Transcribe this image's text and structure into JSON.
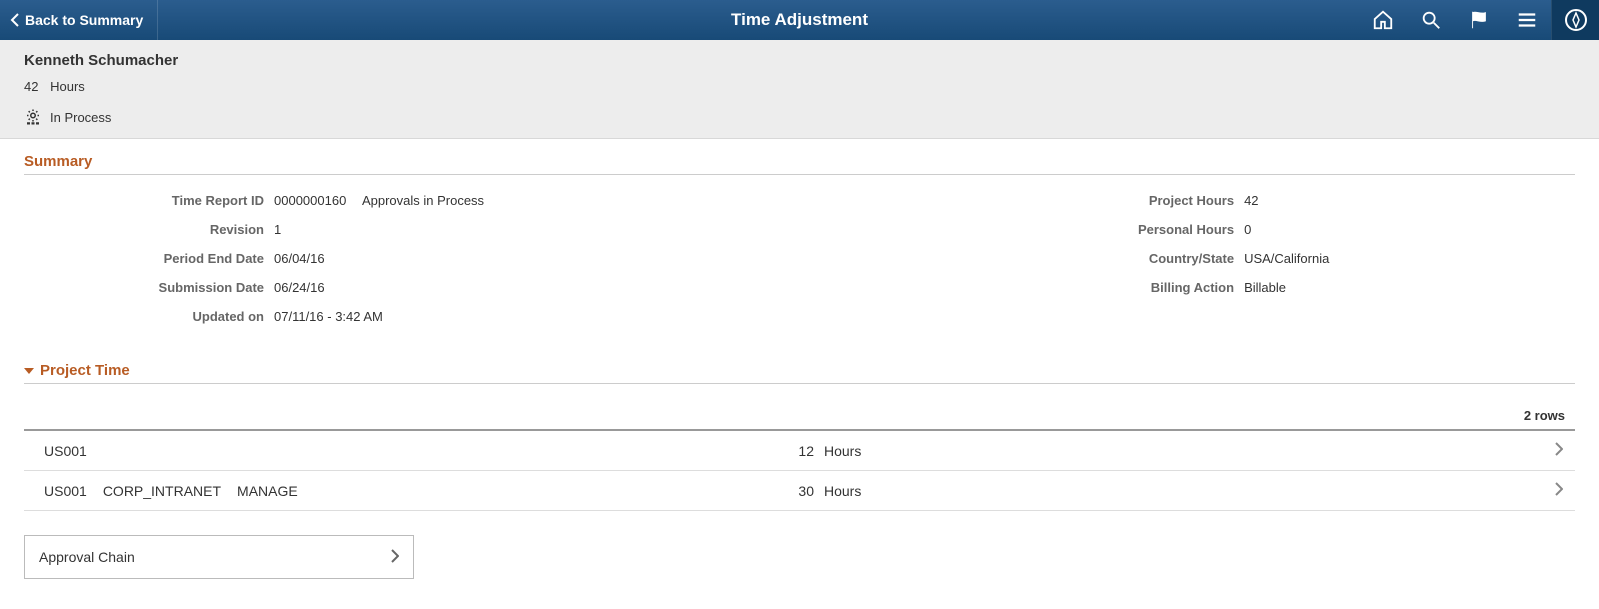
{
  "header": {
    "back_label": "Back to Summary",
    "title": "Time Adjustment"
  },
  "employee": {
    "name": "Kenneth Schumacher",
    "hours_value": "42",
    "hours_unit": "Hours",
    "status": "In Process"
  },
  "summary": {
    "title": "Summary",
    "left": {
      "time_report_id_label": "Time Report ID",
      "time_report_id_value": "0000000160",
      "time_report_status": "Approvals in Process",
      "revision_label": "Revision",
      "revision_value": "1",
      "period_end_label": "Period End Date",
      "period_end_value": "06/04/16",
      "submission_label": "Submission Date",
      "submission_value": "06/24/16",
      "updated_label": "Updated on",
      "updated_value": "07/11/16 - 3:42 AM"
    },
    "right": {
      "project_hours_label": "Project Hours",
      "project_hours_value": "42",
      "personal_hours_label": "Personal Hours",
      "personal_hours_value": "0",
      "country_label": "Country/State",
      "country_value": "USA/California",
      "billing_label": "Billing Action",
      "billing_value": "Billable"
    }
  },
  "project_time": {
    "title": "Project Time",
    "rows_text": "2 rows",
    "rows": [
      {
        "code": "US001",
        "detail1": "",
        "detail2": "",
        "hours": "12",
        "unit": "Hours"
      },
      {
        "code": "US001",
        "detail1": "CORP_INTRANET",
        "detail2": "MANAGE",
        "hours": "30",
        "unit": "Hours"
      }
    ]
  },
  "approval_chain": {
    "label": "Approval Chain"
  }
}
